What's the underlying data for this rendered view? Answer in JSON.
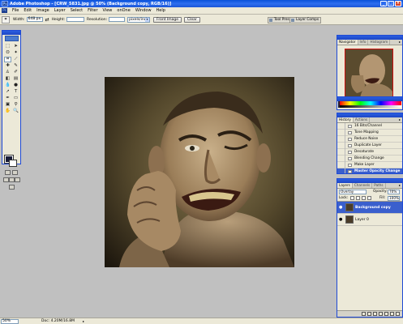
{
  "window": {
    "title": "Adobe Photoshop - [CRW_5831.jpg @ 50% (Background copy, RGB/16)]",
    "minimize": "_",
    "maximize": "□",
    "close": "×"
  },
  "menubar": {
    "items": [
      "File",
      "Edit",
      "Image",
      "Layer",
      "Select",
      "Filter",
      "View",
      "onOne",
      "Window",
      "Help"
    ]
  },
  "options": {
    "width_label": "Width:",
    "width_value": "648 px",
    "swap": "⇄",
    "height_label": "Height:",
    "height_value": "",
    "resolution_label": "Resolution:",
    "resolution_value": "",
    "resolution_unit": "pixels/inch",
    "front_image": "Front Image",
    "clear": "Clear",
    "well_tabs": [
      "Tool Presets",
      "Layer Comps"
    ]
  },
  "colors": {
    "foreground": "#1a1d38",
    "background": "#ffffff",
    "accent": "#1f4ad6",
    "selection": "#3a5fcd"
  },
  "navigator": {
    "tabs": [
      "Navigator",
      "Info",
      "Histogram"
    ],
    "menu_arrow": "▸",
    "zoom": "50%"
  },
  "history": {
    "tabs": [
      "History",
      "Actions"
    ],
    "menu_arrow": "▸",
    "items": [
      {
        "label": "16 Bits/Channel",
        "active": false
      },
      {
        "label": "Tone Mapping",
        "active": false
      },
      {
        "label": "Reduce Noise",
        "active": false
      },
      {
        "label": "Duplicate Layer",
        "active": false
      },
      {
        "label": "Desaturate",
        "active": false
      },
      {
        "label": "Blending Change",
        "active": false
      },
      {
        "label": "Make Layer",
        "active": false
      },
      {
        "label": "Master Opacity Change",
        "active": true
      }
    ]
  },
  "layers": {
    "tabs": [
      "Layers",
      "Channels",
      "Paths"
    ],
    "menu_arrow": "▸",
    "blend_mode": "Overlay",
    "opacity_label": "Opacity:",
    "opacity_value": "70%",
    "lock_label": "Lock:",
    "fill_label": "Fill:",
    "fill_value": "100%",
    "items": [
      {
        "name": "Background copy",
        "active": true,
        "eye": "●"
      },
      {
        "name": "Layer 0",
        "active": false,
        "eye": "●"
      }
    ]
  },
  "statusbar": {
    "zoom": "50%",
    "doc": "Doc: 4.20M/16.8M",
    "arrow": "▸"
  }
}
